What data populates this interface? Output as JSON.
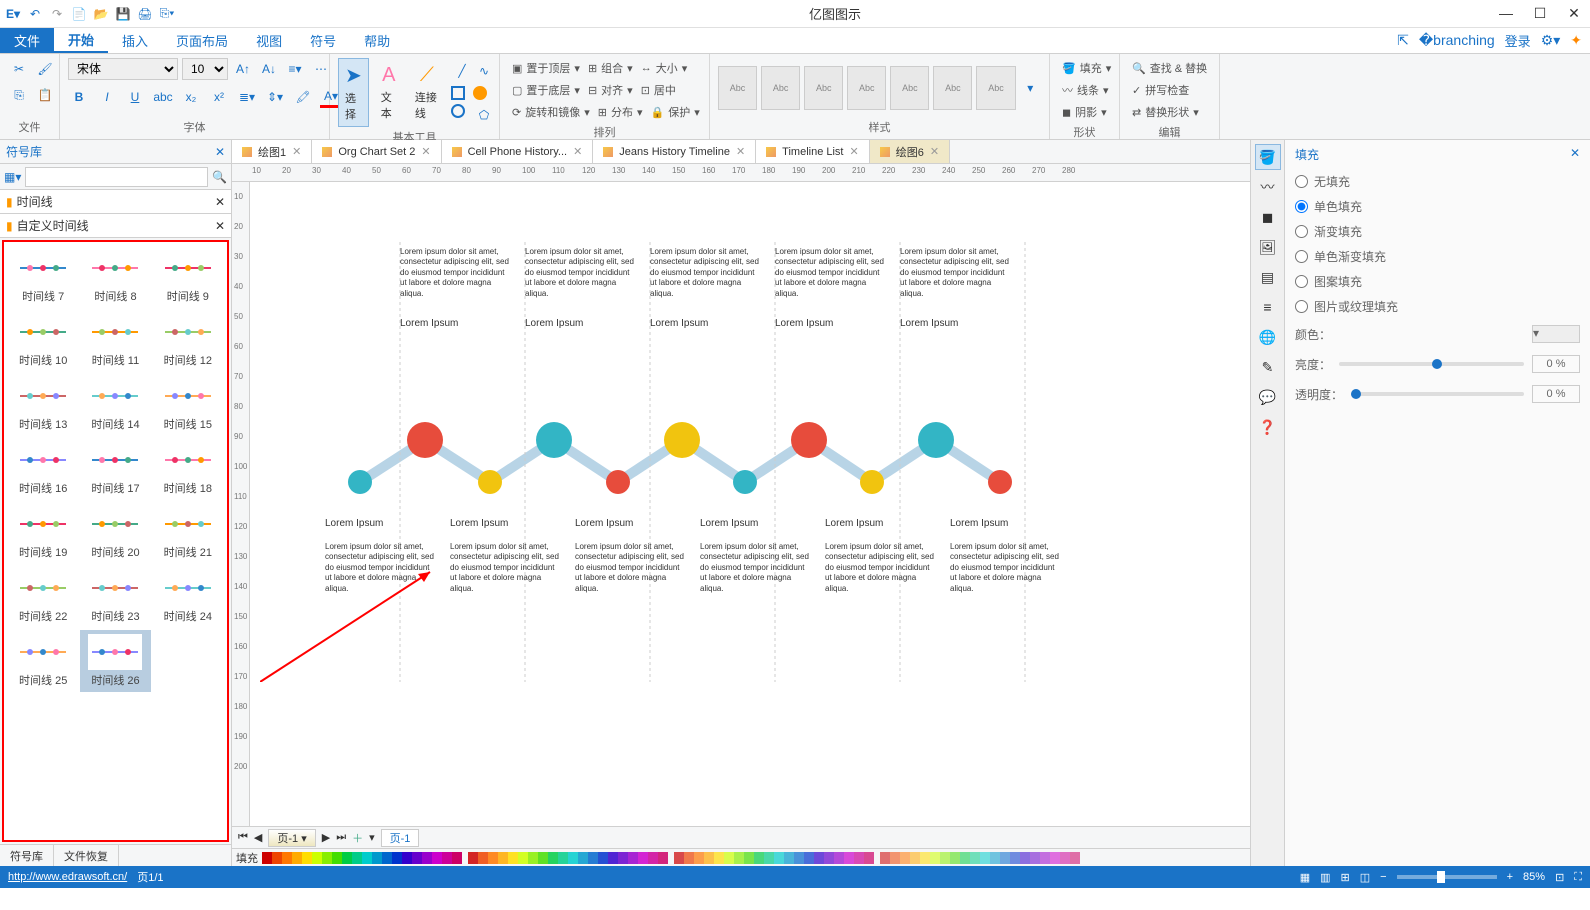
{
  "app": {
    "title": "亿图图示"
  },
  "menu": {
    "file": "文件",
    "tabs": [
      "开始",
      "插入",
      "页面布局",
      "视图",
      "符号",
      "帮助"
    ],
    "active": 0,
    "login": "登录"
  },
  "ribbon": {
    "groups": {
      "file": "文件",
      "font": "字体",
      "tool": "基本工具",
      "arrange": "排列",
      "style": "样式",
      "shape": "形状",
      "edit": "编辑"
    },
    "font": {
      "name": "宋体",
      "size": "10"
    },
    "bigbtns": {
      "select": "选择",
      "text": "文本",
      "connector": "连接线"
    },
    "arrange": {
      "top": "置于顶层",
      "bottom": "置于底层",
      "rotate": "旋转和镜像",
      "group": "组合",
      "align": "对齐",
      "distribute": "分布",
      "size": "大小",
      "center": "居中",
      "protect": "保护"
    },
    "shape": {
      "fill": "填充",
      "line": "线条",
      "shadow": "阴影"
    },
    "edit": {
      "find": "查找 & 替换",
      "spell": "拼写检查",
      "replace": "替换形状"
    },
    "abc": "Abc"
  },
  "tabs": [
    {
      "label": "绘图1"
    },
    {
      "label": "Org Chart Set 2"
    },
    {
      "label": "Cell Phone History..."
    },
    {
      "label": "Jeans History Timeline"
    },
    {
      "label": "Timeline List"
    },
    {
      "label": "绘图6",
      "active": true
    }
  ],
  "symbolLib": {
    "title": "符号库",
    "cat1": "时间线",
    "cat2": "自定义时间线",
    "items": [
      "时间线 7",
      "时间线 8",
      "时间线 9",
      "时间线 10",
      "时间线 11",
      "时间线 12",
      "时间线 13",
      "时间线 14",
      "时间线 15",
      "时间线 16",
      "时间线 17",
      "时间线 18",
      "时间线 19",
      "时间线 20",
      "时间线 21",
      "时间线 22",
      "时间线 23",
      "时间线 24",
      "时间线 25",
      "时间线 26"
    ],
    "selected": 19,
    "bottom": [
      "符号库",
      "文件恢复"
    ]
  },
  "fillPanel": {
    "title": "填充",
    "options": [
      "无填充",
      "单色填充",
      "渐变填充",
      "单色渐变填充",
      "图案填充",
      "图片或纹理填充"
    ],
    "selected": 1,
    "color": "颜色：",
    "brightness": "亮度：",
    "opacity": "透明度：",
    "brightVal": "0 %",
    "opacityVal": "0 %"
  },
  "page": {
    "label": "页-1",
    "pageTab": "页-1"
  },
  "colorBar": {
    "label": "填充"
  },
  "status": {
    "url": "http://www.edrawsoft.cn/",
    "page": "页1/1",
    "zoom": "85%"
  },
  "ruler": {
    "h": [
      "10",
      "20",
      "30",
      "40",
      "50",
      "60",
      "70",
      "80",
      "90",
      "100",
      "110",
      "120",
      "130",
      "140",
      "150",
      "160",
      "170",
      "180",
      "190",
      "200",
      "210",
      "220",
      "230",
      "240",
      "250",
      "260",
      "270",
      "280"
    ],
    "v": [
      "10",
      "20",
      "30",
      "40",
      "50",
      "60",
      "70",
      "80",
      "90",
      "100",
      "110",
      "120",
      "130",
      "140",
      "150",
      "160",
      "170",
      "180",
      "190",
      "200"
    ]
  },
  "timeline": {
    "headings": "Lorem Ipsum",
    "body": "Lorem ipsum dolor sit amet, consectetur adipiscing elit, sed do eiusmod tempor incididunt ut labore et dolore magna aliqua."
  }
}
